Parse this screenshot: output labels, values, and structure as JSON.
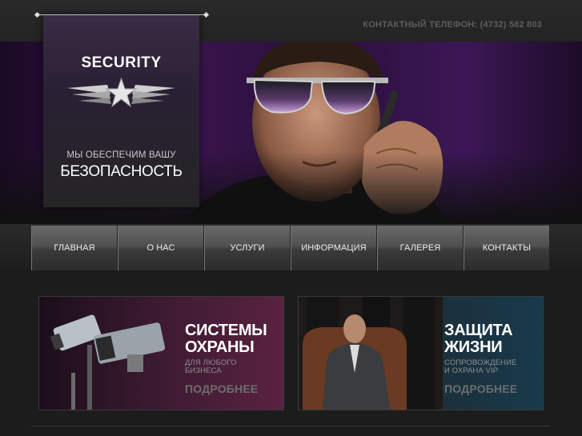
{
  "header": {
    "phone": "КОНТАКТНЫЙ ТЕЛЕФОН: (4732) 582 803"
  },
  "logo": {
    "title": "SECURITY",
    "tagline_line1": "МЫ ОБЕСПЕЧИМ ВАШУ",
    "tagline_line2": "БЕЗОПАСНОСТЬ",
    "icon": "star-wings-badge-icon"
  },
  "nav": {
    "items": [
      {
        "label": "ГЛАВНАЯ"
      },
      {
        "label": "О НАС"
      },
      {
        "label": "УСЛУГИ"
      },
      {
        "label": "ИНФОРМАЦИЯ"
      },
      {
        "label": "ГАЛЕРЕЯ"
      },
      {
        "label": "КОНТАКТЫ"
      }
    ]
  },
  "cards": [
    {
      "title_line1": "СИСТЕМЫ",
      "title_line2": "ОХРАНЫ",
      "sub_line1": "ДЛЯ ЛЮБОГО",
      "sub_line2": "БИЗНЕСА",
      "more": "ПОДРОБНЕЕ",
      "image": "cctv-cameras"
    },
    {
      "title_line1": "ЗАЩИТА",
      "title_line2": "ЖИЗНИ",
      "sub_line1": "СОПРОВОЖДЕНИЕ",
      "sub_line2": "И ОХРАНА VIP",
      "more": "ПОДРОБНЕЕ",
      "image": "vip-with-bodyguards"
    }
  ],
  "colors": {
    "background": "#1c1c1c",
    "accent_purple": "#3a1550",
    "nav_gradient_top": "#6a6a6a",
    "text_white": "#ffffff"
  }
}
